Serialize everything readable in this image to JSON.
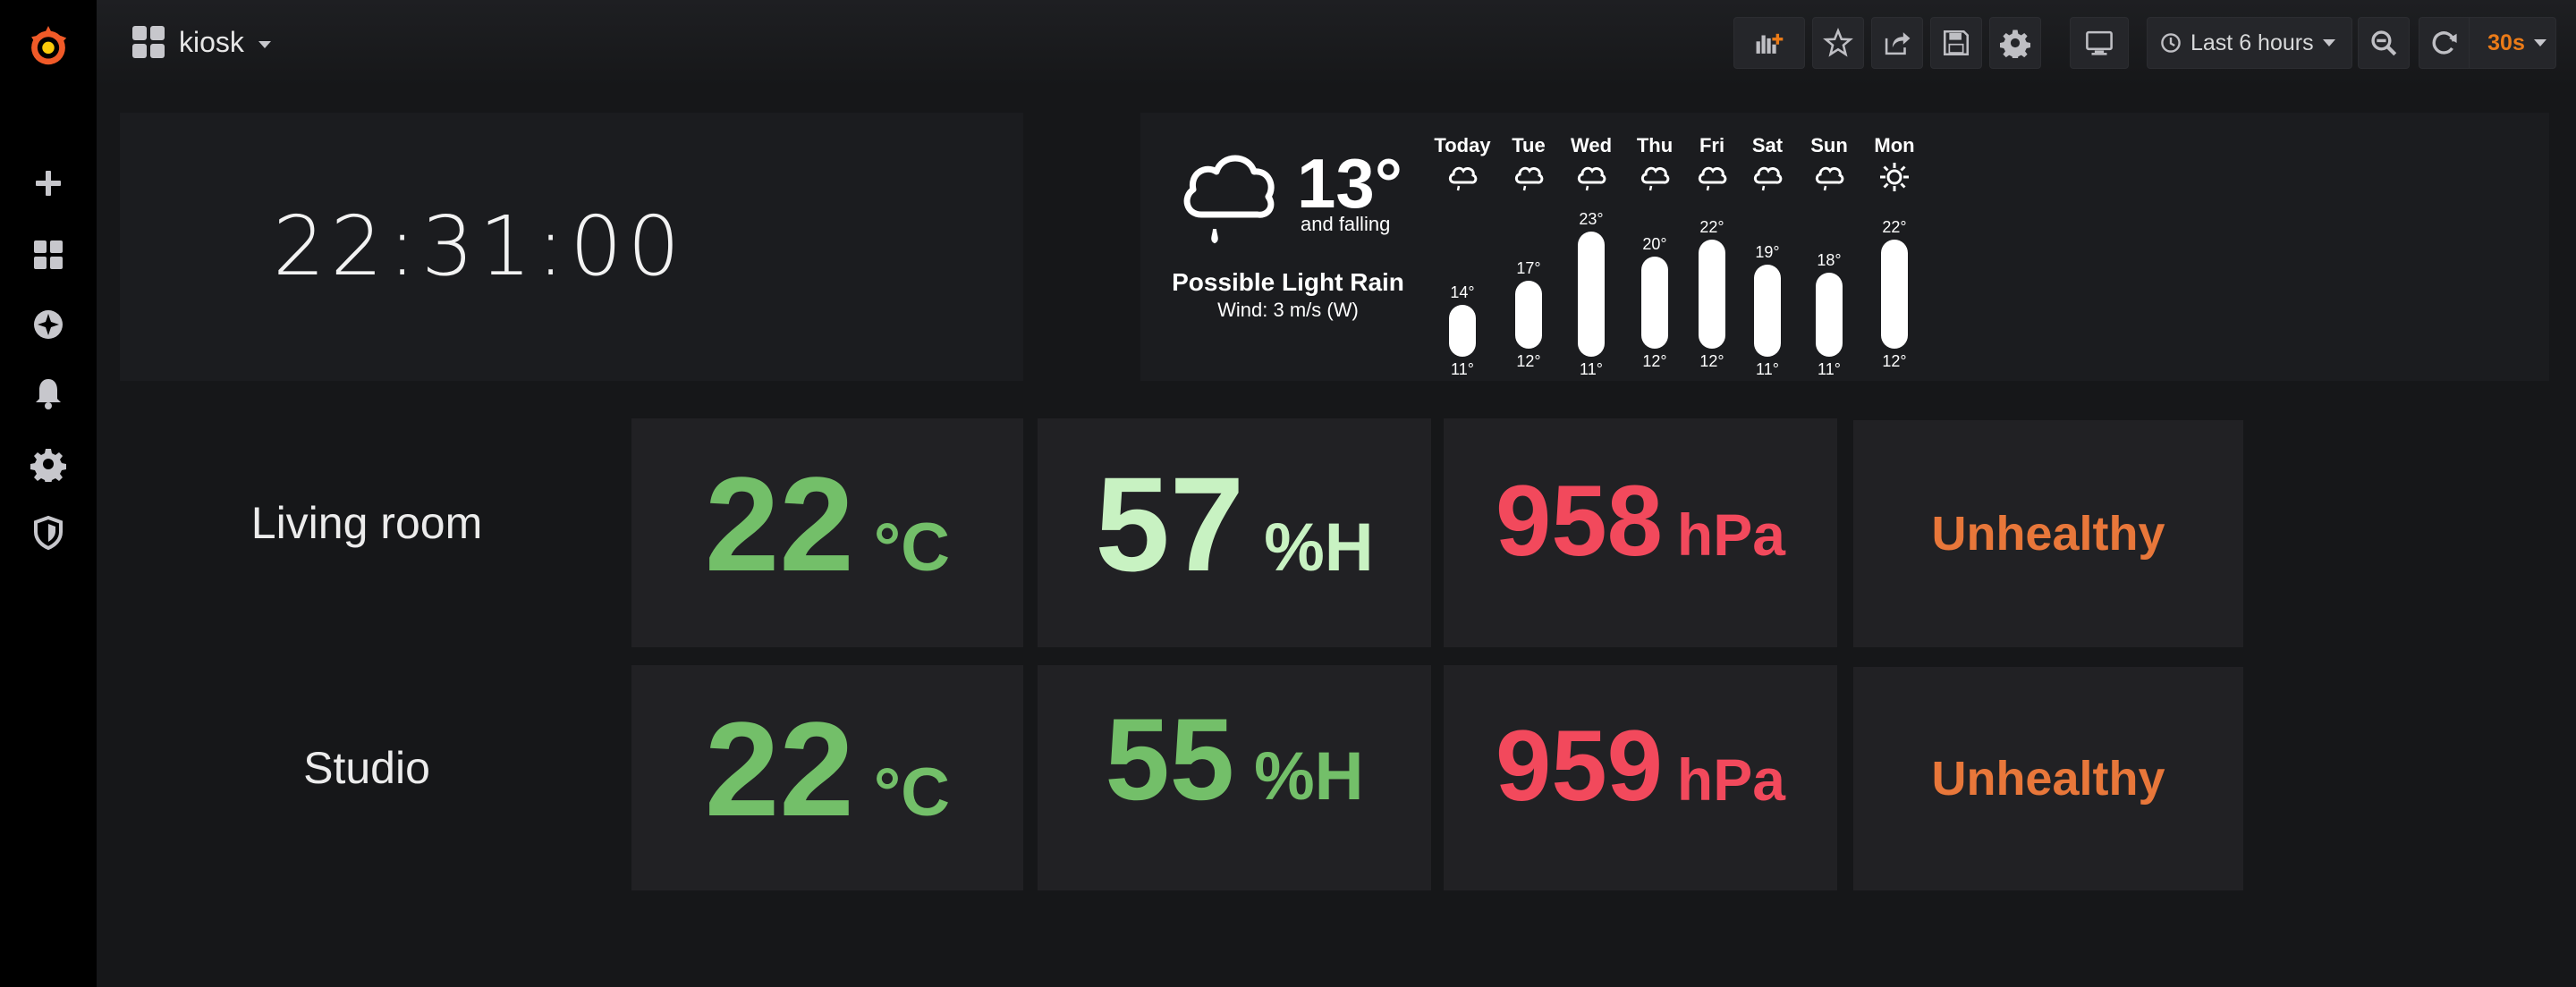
{
  "dashboard": {
    "title": "kiosk"
  },
  "sidebar": {
    "items": [
      {
        "icon": "grafana-logo-icon"
      },
      {
        "icon": "plus-icon"
      },
      {
        "icon": "dashboards-icon"
      },
      {
        "icon": "explore-compass-icon"
      },
      {
        "icon": "alerting-bell-icon"
      },
      {
        "icon": "configuration-gear-icon"
      },
      {
        "icon": "shield-icon"
      }
    ]
  },
  "toolbar": {
    "time_range": "Last 6 hours",
    "refresh": "30s"
  },
  "clock": {
    "time": "22:31:00"
  },
  "weather": {
    "current_temp": "13°",
    "trend": "and falling",
    "condition": "Possible Light Rain",
    "wind": "Wind: 3 m/s (W)",
    "forecast": [
      {
        "day": "Today",
        "hi": "14°",
        "lo": "11°",
        "hi_v": 14,
        "lo_v": 11,
        "icon": "rain"
      },
      {
        "day": "Tue",
        "hi": "17°",
        "lo": "12°",
        "hi_v": 17,
        "lo_v": 12,
        "icon": "rain"
      },
      {
        "day": "Wed",
        "hi": "23°",
        "lo": "11°",
        "hi_v": 23,
        "lo_v": 11,
        "icon": "rain"
      },
      {
        "day": "Thu",
        "hi": "20°",
        "lo": "12°",
        "hi_v": 20,
        "lo_v": 12,
        "icon": "rain"
      },
      {
        "day": "Fri",
        "hi": "22°",
        "lo": "12°",
        "hi_v": 22,
        "lo_v": 12,
        "icon": "rain"
      },
      {
        "day": "Sat",
        "hi": "19°",
        "lo": "11°",
        "hi_v": 19,
        "lo_v": 11,
        "icon": "rain"
      },
      {
        "day": "Sun",
        "hi": "18°",
        "lo": "11°",
        "hi_v": 18,
        "lo_v": 11,
        "icon": "rain"
      },
      {
        "day": "Mon",
        "hi": "22°",
        "lo": "12°",
        "hi_v": 22,
        "lo_v": 12,
        "icon": "sun"
      }
    ]
  },
  "rooms": [
    {
      "name": "Living room",
      "temperature": {
        "value": "22",
        "unit": "°C"
      },
      "humidity": {
        "value": "57",
        "unit": "%H"
      },
      "pressure": {
        "value": "958",
        "unit": "hPa"
      },
      "air_quality": "Unhealthy"
    },
    {
      "name": "Studio",
      "temperature": {
        "value": "22",
        "unit": "°C"
      },
      "humidity": {
        "value": "55",
        "unit": "%H"
      },
      "pressure": {
        "value": "959",
        "unit": "hPa"
      },
      "air_quality": "Unhealthy"
    }
  ],
  "colors": {
    "temp_green": "#73bf69",
    "humidity_light": "#c8f2c2",
    "humidity_green": "#73bf69",
    "pressure_red": "#f2495c",
    "air_quality_orange": "#e8773a",
    "refresh_orange": "#eb7b18"
  }
}
